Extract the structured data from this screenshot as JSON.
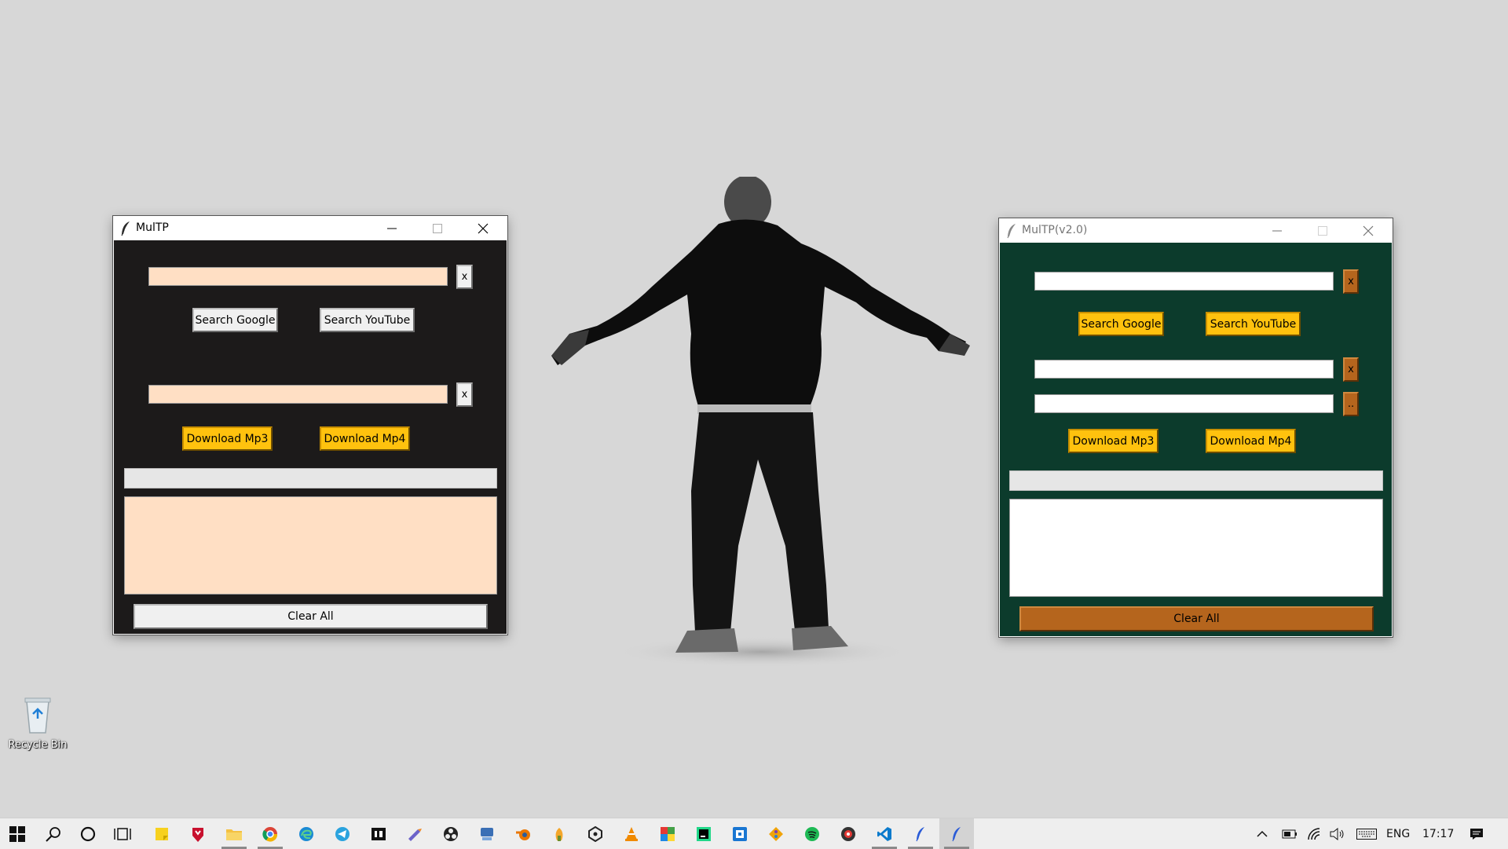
{
  "desktop": {
    "recycle_bin_label": "Recycle Bin"
  },
  "window1": {
    "title": "MulTP",
    "clear_search_label": "x",
    "clear_url_label": "x",
    "search_google_label": "Search Google",
    "search_youtube_label": "Search YouTube",
    "download_mp3_label": "Download Mp3",
    "download_mp4_label": "Download Mp4",
    "clear_all_label": "Clear All",
    "theme": {
      "background": "#1c1a1a",
      "entry": "#ffdfc4",
      "button": "#ffc20e"
    }
  },
  "window2": {
    "title": "MulTP(v2.0)",
    "clear_search_label": "x",
    "clear_url_label": "x",
    "browse_label": "..",
    "search_google_label": "Search Google",
    "search_youtube_label": "Search YouTube",
    "download_mp3_label": "Download Mp3",
    "download_mp4_label": "Download Mp4",
    "clear_all_label": "Clear All",
    "theme": {
      "background": "#0c3b2c",
      "button": "#ffc20e",
      "accent": "#b5651d"
    }
  },
  "taskbar": {
    "pinned_icons": [
      "windows-start-icon",
      "search-icon",
      "cortana-icon",
      "task-view-icon",
      "sticky-notes-icon",
      "mcafee-icon",
      "file-explorer-icon",
      "chrome-icon",
      "edge-icon",
      "telegram-icon",
      "imdb-icon",
      "pencil-app-icon",
      "obs-icon",
      "network-app-icon",
      "blender-icon",
      "fl-studio-icon",
      "unity-icon",
      "vlc-icon",
      "color-grid-app-icon",
      "pycharm-icon",
      "sandbox-app-icon",
      "git-icon",
      "spotify-icon",
      "media-app-icon",
      "vscode-icon",
      "feather-app-icon",
      "feather-app-icon"
    ],
    "language": "ENG",
    "time": "17:17"
  }
}
